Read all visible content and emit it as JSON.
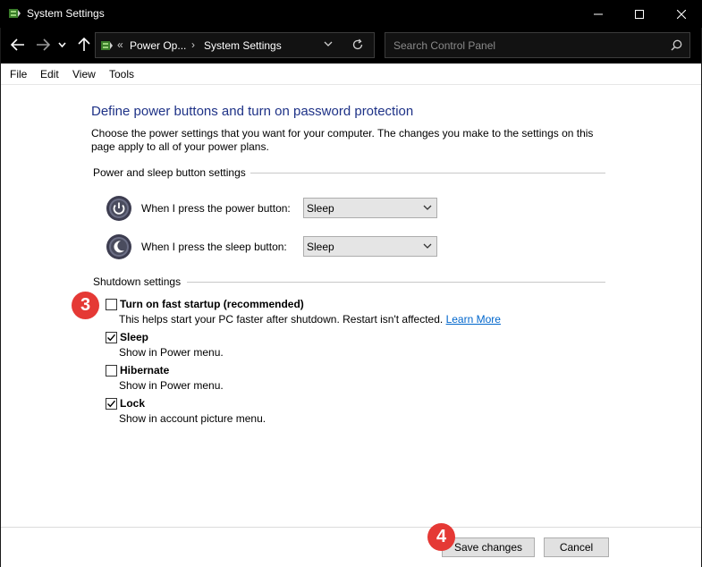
{
  "window": {
    "title": "System Settings",
    "icons": {
      "app": "power-options-icon",
      "minimize": "minimize-icon",
      "maximize": "maximize-icon",
      "close": "close-icon"
    }
  },
  "nav": {
    "breadcrumb_prefix": "«",
    "breadcrumb_1": "Power Op...",
    "breadcrumb_sep": "›",
    "breadcrumb_2": "System Settings",
    "search_placeholder": "Search Control Panel"
  },
  "menu": {
    "file": "File",
    "edit": "Edit",
    "view": "View",
    "tools": "Tools"
  },
  "main": {
    "heading": "Define power buttons and turn on password protection",
    "description": "Choose the power settings that you want for your computer. The changes you make to the settings on this page apply to all of your power plans.",
    "power_section_label": "Power and sleep button settings",
    "power_button_label": "When I press the power button:",
    "power_button_value": "Sleep",
    "sleep_button_label": "When I press the sleep button:",
    "sleep_button_value": "Sleep",
    "shutdown_section_label": "Shutdown settings",
    "options": [
      {
        "title": "Turn on fast startup (recommended)",
        "subtitle": "This helps start your PC faster after shutdown. Restart isn't affected.",
        "link": "Learn More",
        "checked": false
      },
      {
        "title": "Sleep",
        "subtitle": "Show in Power menu.",
        "checked": true
      },
      {
        "title": "Hibernate",
        "subtitle": "Show in Power menu.",
        "checked": false
      },
      {
        "title": "Lock",
        "subtitle": "Show in account picture menu.",
        "checked": true
      }
    ]
  },
  "footer": {
    "save_label": "Save changes",
    "cancel_label": "Cancel"
  },
  "badges": {
    "step_3": "3",
    "step_4": "4"
  },
  "colors": {
    "heading": "#1e3287",
    "link": "#0066cc",
    "badge": "#e53935"
  }
}
